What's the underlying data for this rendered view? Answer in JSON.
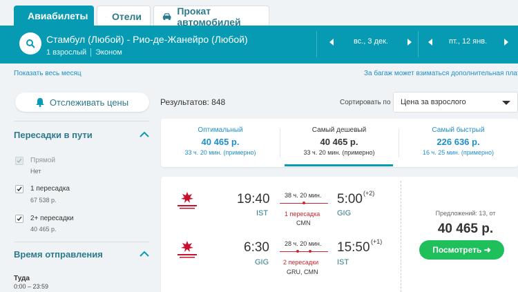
{
  "tabs": [
    {
      "label": "Авиабилеты",
      "icon": "plane-icon",
      "active": true
    },
    {
      "label": "Отели",
      "icon": "bed-icon",
      "active": false
    },
    {
      "label": "Прокат автомобилей",
      "icon": "car-icon",
      "active": false
    }
  ],
  "search": {
    "route": "Стамбул (Любой) - Рио-де-Жанейро (Любой)",
    "passengers": "1 взрослый",
    "cabin": "Эконом",
    "depart_date": "вс., 3 дек.",
    "return_date": "пт., 12 янв."
  },
  "links": {
    "show_month": "Показать весь месяц",
    "baggage_note": "За багаж может взиматься дополнительная плата"
  },
  "track_button": "Отслеживать цены",
  "results": {
    "count_label": "Результатов: 848",
    "sort_label": "Сортировать по",
    "sort_value": "Цена за взрослого"
  },
  "sidebar": {
    "stops_title": "Пересадки в пути",
    "options": [
      {
        "label": "Прямой",
        "sub": "Нет",
        "checked": true,
        "disabled": true
      },
      {
        "label": "1 пересадка",
        "sub": "67 538 р.",
        "checked": true,
        "disabled": false
      },
      {
        "label": "2+ пересадки",
        "sub": "40 465 р.",
        "checked": true,
        "disabled": false
      }
    ],
    "departure_title": "Время отправления",
    "departure_label": "Туда",
    "departure_range": "0:00 – 23:59"
  },
  "summary": [
    {
      "title": "Оптимальный",
      "price": "40 465 р.",
      "duration": "33 ч. 20 мин. (примерно)",
      "selected": false
    },
    {
      "title": "Самый дешевый",
      "price": "40 465 р.",
      "duration": "33 ч. 20 мин. (примерно)",
      "selected": true
    },
    {
      "title": "Самый быстрый",
      "price": "226 636 р.",
      "duration": "16 ч. 25 мин. (примерно)",
      "selected": false
    }
  ],
  "result": {
    "legs": [
      {
        "dep_time": "19:40",
        "dep_code": "IST",
        "duration": "38 ч. 20 мин.",
        "stops": "1 пересадка",
        "via": "CMN",
        "arr_time": "5:00",
        "arr_plus": "(+2)",
        "arr_code": "GIG"
      },
      {
        "dep_time": "6:30",
        "dep_code": "GIG",
        "duration": "28 ч. 20 мин.",
        "stops": "2 пересадки",
        "via": "GRU, CMN",
        "arr_time": "15:50",
        "arr_plus": "(+1)",
        "arr_code": "IST"
      }
    ],
    "offers": "Предложений: 13, от",
    "price": "40 465 р.",
    "button": "Посмотреть ➜"
  },
  "colors": {
    "accent": "#069ab3",
    "link": "#1e8ecb",
    "stops_red": "#d0232a",
    "cta_green": "#1fbf5c"
  }
}
